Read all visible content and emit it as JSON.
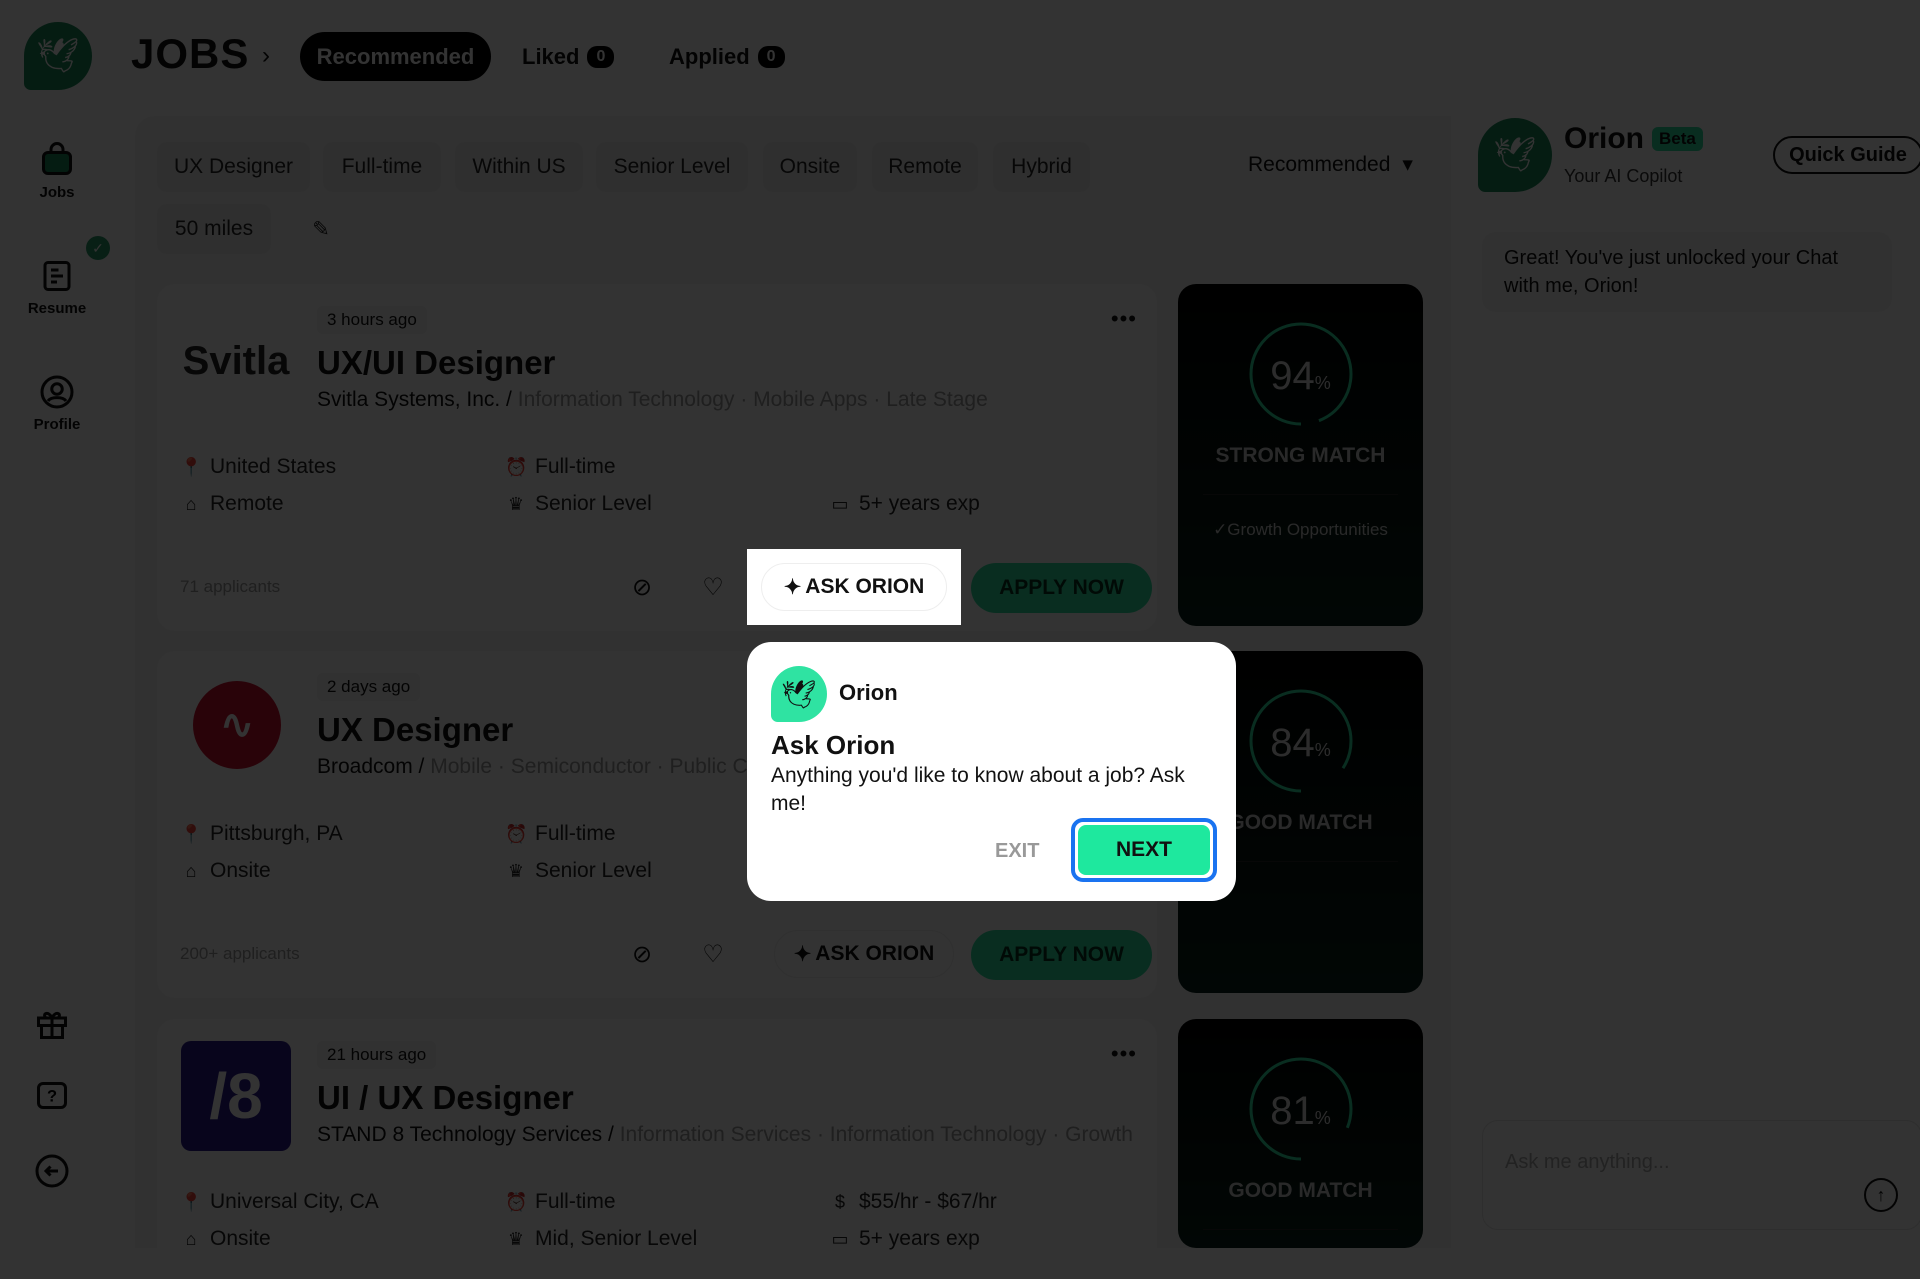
{
  "header": {
    "title": "JOBS",
    "tabs": [
      {
        "label": "Recommended",
        "active": true
      },
      {
        "label": "Liked",
        "count": "0"
      },
      {
        "label": "Applied",
        "count": "0"
      }
    ]
  },
  "sidebar": {
    "items": [
      {
        "label": "Jobs",
        "icon": "briefcase-icon"
      },
      {
        "label": "Resume",
        "icon": "resume-icon"
      },
      {
        "label": "Profile",
        "icon": "user-icon"
      }
    ],
    "bottom_icons": [
      "gift-icon",
      "help-icon",
      "logout-icon"
    ]
  },
  "filters": {
    "chips": [
      "UX Designer",
      "Full-time",
      "Within US",
      "Senior Level",
      "Onsite",
      "Remote",
      "Hybrid"
    ],
    "distance": "50 miles",
    "sort": "Recommended"
  },
  "jobs": [
    {
      "posted": "3 hours ago",
      "title": "UX/UI Designer",
      "company": "Svitla Systems, Inc.",
      "tags": "Information Technology · Mobile Apps · Late Stage",
      "logo_text": "Svitla",
      "logo_color": "#222222",
      "logo_bg": "#ffffff",
      "details": [
        [
          {
            "icon": "location",
            "text": "United States"
          },
          {
            "icon": "clock",
            "text": "Full-time"
          },
          null
        ],
        [
          {
            "icon": "home",
            "text": "Remote"
          },
          {
            "icon": "crown",
            "text": "Senior Level"
          },
          {
            "icon": "calendar",
            "text": "5+ years exp"
          }
        ]
      ],
      "applicants": "71 applicants",
      "match": {
        "percent": 94,
        "label": "STRONG MATCH",
        "highlight": "✓Growth Opportunities"
      }
    },
    {
      "posted": "2 days ago",
      "title": "UX Designer",
      "company": "Broadcom",
      "tags": "Mobile · Semiconductor · Public Company",
      "logo_text": "",
      "logo_color": "#ffffff",
      "logo_bg": "#cc0f2f",
      "details": [
        [
          {
            "icon": "location",
            "text": "Pittsburgh, PA"
          },
          {
            "icon": "clock",
            "text": "Full-time"
          },
          null
        ],
        [
          {
            "icon": "home",
            "text": "Onsite"
          },
          {
            "icon": "crown",
            "text": "Senior Level"
          },
          null
        ]
      ],
      "applicants": "200+ applicants",
      "match": {
        "percent": 84,
        "label": "GOOD MATCH",
        "highlight": ""
      }
    },
    {
      "posted": "21 hours ago",
      "title": "UI / UX Designer",
      "company": "STAND 8 Technology Services",
      "tags": "Information Services · Information Technology · Growth Stage",
      "logo_text": "/8",
      "logo_color": "#ffffff",
      "logo_bg": "#2a1a8c",
      "details": [
        [
          {
            "icon": "location",
            "text": "Universal City, CA"
          },
          {
            "icon": "clock",
            "text": "Full-time"
          },
          {
            "icon": "dollar",
            "text": "$55/hr - $67/hr"
          }
        ],
        [
          {
            "icon": "home",
            "text": "Onsite"
          },
          {
            "icon": "crown",
            "text": "Mid, Senior Level"
          },
          {
            "icon": "calendar",
            "text": "5+ years exp"
          }
        ]
      ],
      "applicants": "",
      "match": {
        "percent": 81,
        "label": "GOOD MATCH",
        "highlight": ""
      }
    }
  ],
  "actions": {
    "ask": "ASK ORION",
    "apply": "APPLY NOW"
  },
  "copilot": {
    "name": "Orion",
    "badge": "Beta",
    "subtitle": "Your AI Copilot",
    "guide": "Quick Guide",
    "message": "Great! You've just unlocked your Chat with me, Orion!",
    "placeholder": "Ask me anything..."
  },
  "tour": {
    "name": "Orion",
    "title": "Ask Orion",
    "body": "Anything you'd like to know about a job? Ask me!",
    "exit": "EXIT",
    "next": "NEXT"
  },
  "colors": {
    "accent": "#2fe3a2",
    "brand": "#1b8a5a",
    "focus": "#1a73f0"
  }
}
